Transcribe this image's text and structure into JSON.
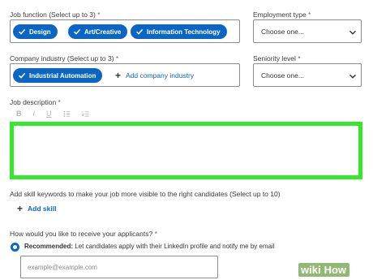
{
  "job_function": {
    "label": "Job function (Select up to 3)",
    "required_mark": "*",
    "chips": [
      "Design",
      "Art/Creative",
      "Information Technology"
    ]
  },
  "employment_type": {
    "label": "Employment type",
    "required_mark": "*",
    "value": "Choose one..."
  },
  "company_industry": {
    "label": "Company industry (Select up to 3)",
    "required_mark": "*",
    "chips": [
      "Industrial Automation"
    ],
    "add_label": "Add company industry"
  },
  "seniority_level": {
    "label": "Seniority level",
    "required_mark": "*",
    "value": "Choose one..."
  },
  "job_description": {
    "label": "Job description",
    "required_mark": "*",
    "toolbar": {
      "bold": "B",
      "italic": "I",
      "underline": "U"
    }
  },
  "skills": {
    "label": "Add skill keywords to make your job more visible to the right candidates (Select up to 10)",
    "add_label": "Add skill"
  },
  "applicants": {
    "label": "How would you like to receive your applicants?",
    "required_mark": "*",
    "option_bold": "Recommended:",
    "option_text": " Let candidates apply with their LinkedIn profile and notify me by email",
    "email_placeholder": "example@example.com"
  },
  "watermark": {
    "part1": "wiki",
    "part2": "How"
  },
  "colors": {
    "accent": "#0a66c2",
    "highlight": "#34e82a"
  }
}
